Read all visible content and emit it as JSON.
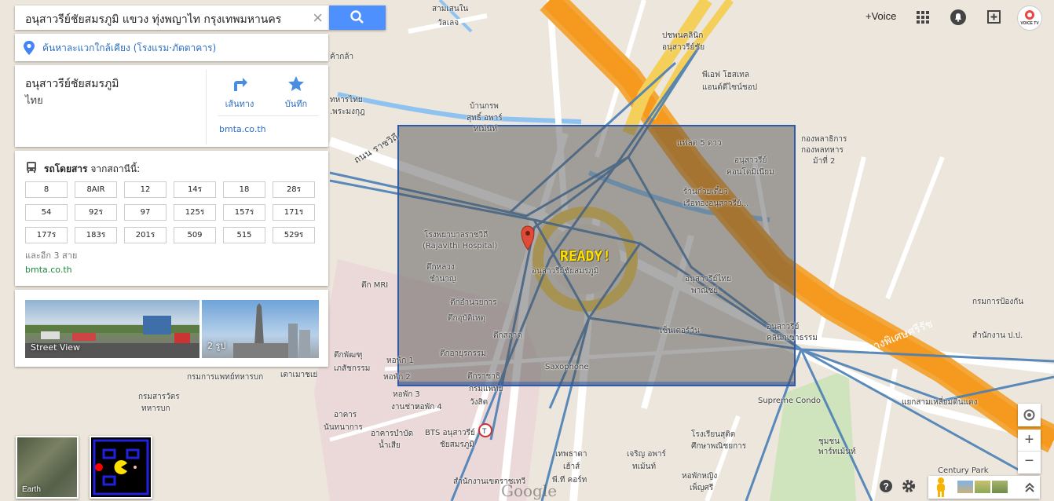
{
  "search": {
    "query": "อนุสาวรีย์ชัยสมรภูมิ แขวง ทุ่งพญาไท กรุงเทพมหานคร"
  },
  "nearby": {
    "label": "ค้นหาละแวกใกล้เคียง (โรงแรม·ภัตตาคาร)"
  },
  "place": {
    "name": "อนุสาวรีย์ชัยสมรภูมิ",
    "country": "ไทย",
    "directions_label": "เส้นทาง",
    "save_label": "บันทึก",
    "website": "bmta.co.th"
  },
  "transit": {
    "title_bold": "รถโดยสาร",
    "title_rest": " จากสถานีนี้:",
    "routes": [
      "8",
      "8AIR",
      "12",
      "14ร",
      "18",
      "28ร",
      "54",
      "92ร",
      "97",
      "125ร",
      "157ร",
      "171ร",
      "177ร",
      "183ร",
      "201ร",
      "509",
      "515",
      "529ร"
    ],
    "more": "และอีก 3 สาย",
    "website": "bmta.co.th"
  },
  "photos": {
    "street_view_label": "Street View",
    "photos_label": "2 รูป"
  },
  "topbar": {
    "voice_label": "+Voice",
    "voice_badge": "VOICE TV"
  },
  "thumbnails": {
    "earth_label": "Earth"
  },
  "overlay": {
    "ready_text": "READY!",
    "google_logo": "Google"
  },
  "map_labels": [
    {
      "text": "สามเสนใน",
      "cls": "l1"
    },
    {
      "text": "วัลเลจ",
      "cls": "l2"
    },
    {
      "text": "ปชพนคลินิก",
      "cls": "l3"
    },
    {
      "text": "อนุสาวรีย์ชัย",
      "cls": "l4"
    },
    {
      "text": "พีเอฟ โฮสเทล",
      "cls": "l5"
    },
    {
      "text": "แอนด์ดีไซน์ชอป",
      "cls": "l6"
    },
    {
      "text": "บ้านกรพ",
      "cls": "l7"
    },
    {
      "text": "สุทธิ์ อพาร์",
      "cls": "l8"
    },
    {
      "text": "ทเม้นท์",
      "cls": "l9"
    },
    {
      "text": "ทหารไทย",
      "cls": "l10"
    },
    {
      "text": ".พระมงกุฎ",
      "cls": "l11"
    },
    {
      "text": "ค้ากล้า",
      "cls": "l12"
    },
    {
      "text": "กองพลาธิการ",
      "cls": "l13"
    },
    {
      "text": "กองพลทหาร",
      "cls": "l14"
    },
    {
      "text": "ม้าที่ 2",
      "cls": "l15"
    },
    {
      "text": "แฟลต 5 ดาว",
      "cls": "l16"
    },
    {
      "text": "อนุสาวรีย์",
      "cls": "l17"
    },
    {
      "text": "คอนโดมิเนียม",
      "cls": "l18"
    },
    {
      "text": "ร้านก๋วยเตี๋ยว",
      "cls": "l19"
    },
    {
      "text": "เรือทองอนุสาวรีย์...",
      "cls": "l20"
    },
    {
      "text": "โรงพยาบาลราชวิถี",
      "cls": "l21"
    },
    {
      "text": "(Rajavithi Hospital)",
      "cls": "l22"
    },
    {
      "text": "ตึกหลวง",
      "cls": "l23"
    },
    {
      "text": "ชำนาญ",
      "cls": "l24"
    },
    {
      "text": "อนุสาวรีย์ชัยสมรภูมิ",
      "cls": "l25"
    },
    {
      "text": "ตึก MRI",
      "cls": "l26"
    },
    {
      "text": "ตึกอำนวยการ",
      "cls": "l27"
    },
    {
      "text": "ตึกอุบัติเหตุ",
      "cls": "l28"
    },
    {
      "text": "ตึกสลาด",
      "cls": "l29"
    },
    {
      "text": "ตึกอายุรกรรม",
      "cls": "l30"
    },
    {
      "text": "อนุสาวรีย์",
      "cls": "l31"
    },
    {
      "text": "คลินิกเซาธรรม",
      "cls": "l32"
    },
    {
      "text": "ตึกพัฒฑุ",
      "cls": "l33"
    },
    {
      "text": "เภสัชกรรม",
      "cls": "l34"
    },
    {
      "text": "กรมการแพทย์ทหารบก",
      "cls": "l35"
    },
    {
      "text": "เตาเมาชเย่",
      "cls": "l36"
    },
    {
      "text": "หอพัก 1",
      "cls": "l37"
    },
    {
      "text": "หอพัก 2",
      "cls": "l38"
    },
    {
      "text": "หอพัก 3",
      "cls": "l39"
    },
    {
      "text": "งานช่าง",
      "cls": "l40"
    },
    {
      "text": "หอพัก 4",
      "cls": "l41"
    },
    {
      "text": "ตึกราชาธิ",
      "cls": "l42"
    },
    {
      "text": "กรมแพทย",
      "cls": "l43"
    },
    {
      "text": "วังสิต",
      "cls": "l44"
    },
    {
      "text": "Saxophone",
      "cls": "l45"
    },
    {
      "text": "เซ็นเตอร์วัน",
      "cls": "l46"
    },
    {
      "text": "อนุสาวรีย์ไทย",
      "cls": "l47"
    },
    {
      "text": "พาณิชย์",
      "cls": "l48"
    },
    {
      "text": "Supreme Condo",
      "cls": "l49"
    },
    {
      "text": "แยกสามเหลี่ยมดินแดง",
      "cls": "l50"
    },
    {
      "text": "กรมการป้องกัน",
      "cls": "l51"
    },
    {
      "text": "สำนักงาน ป.ป.",
      "cls": "l52"
    },
    {
      "text": "โรงเรียนสุติต",
      "cls": "l53"
    },
    {
      "text": "ศึกษาพณิชยการ",
      "cls": "l54"
    },
    {
      "text": "ชุมชน",
      "cls": "l55"
    },
    {
      "text": "พาร์ทเม้นท์",
      "cls": "l56"
    },
    {
      "text": "Century Park",
      "cls": "l57"
    },
    {
      "text": "BTS อนุสาวรีย์",
      "cls": "l58"
    },
    {
      "text": "ชัยสมรภูมิ",
      "cls": "l59"
    },
    {
      "text": "เทพธาดา",
      "cls": "l60"
    },
    {
      "text": "เฮ้าส์",
      "cls": "l61"
    },
    {
      "text": "เจริญ อพาร์",
      "cls": "l62"
    },
    {
      "text": "ทเม้นท์",
      "cls": "l63"
    },
    {
      "text": "พี.ที คอร์ท",
      "cls": "l64"
    },
    {
      "text": "หอพักหญิง",
      "cls": "l65"
    },
    {
      "text": "เพ็ญศรี",
      "cls": "l66"
    },
    {
      "text": "กรมสารวัตร",
      "cls": "l67"
    },
    {
      "text": "ทหารบก",
      "cls": "l68"
    },
    {
      "text": "อาคาร",
      "cls": "l69"
    },
    {
      "text": "นันทนาการ",
      "cls": "l70"
    },
    {
      "text": "อาคารบำบัด",
      "cls": "l71"
    },
    {
      "text": "น้ำเสีย",
      "cls": "l72"
    },
    {
      "text": "สำนักงานเขตราชเทวี",
      "cls": "l73"
    },
    {
      "text": "ทางพิเศษศรีรัช",
      "cls": "l74"
    },
    {
      "text": "ถนน ราชวิถี",
      "cls": "l75"
    }
  ]
}
